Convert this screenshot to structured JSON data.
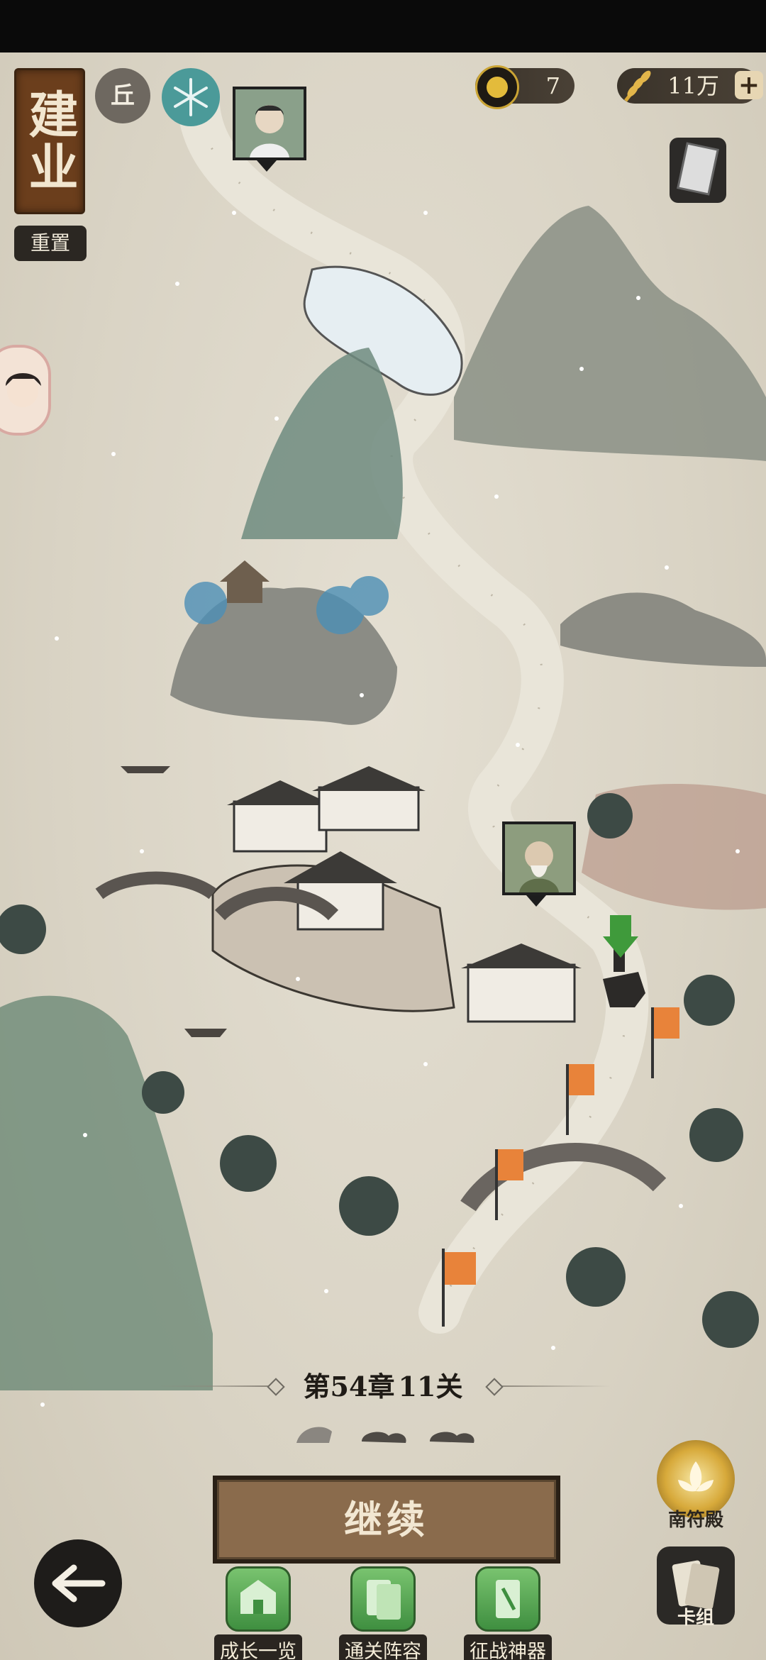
{
  "region": {
    "name": "建业",
    "reset_label": "重置",
    "terrain": "丘",
    "weather_icon": "snowflake-icon"
  },
  "resources": {
    "coins": "7",
    "grain": "11万",
    "coin_icon": "coin-icon",
    "grain_icon": "wheat-icon",
    "add_label": "+"
  },
  "chapter": {
    "title_prefix": "第",
    "chapter_num": "54",
    "title_mid": "章",
    "stage_num": "11",
    "title_suffix": "关"
  },
  "buttons": {
    "continue_label": "继续"
  },
  "bottom_nav": [
    {
      "label": "成长一览",
      "icon": "growth-overview-icon"
    },
    {
      "label": "通关阵容",
      "icon": "clear-lineup-icon"
    },
    {
      "label": "征战神器",
      "icon": "artifact-icon"
    }
  ],
  "right_side": [
    {
      "label": "南符殿",
      "icon": "lotus-icon"
    },
    {
      "label": "卡组",
      "icon": "deck-icon"
    }
  ],
  "colors": {
    "parchment": "#d9d3c4",
    "ink": "#1f1b16",
    "button_brown": "#8a6b4c",
    "plate_brown": "#6b3e1c",
    "teal": "#4b9a99",
    "green": "#4e9a43",
    "flag_orange": "#e8833a"
  }
}
